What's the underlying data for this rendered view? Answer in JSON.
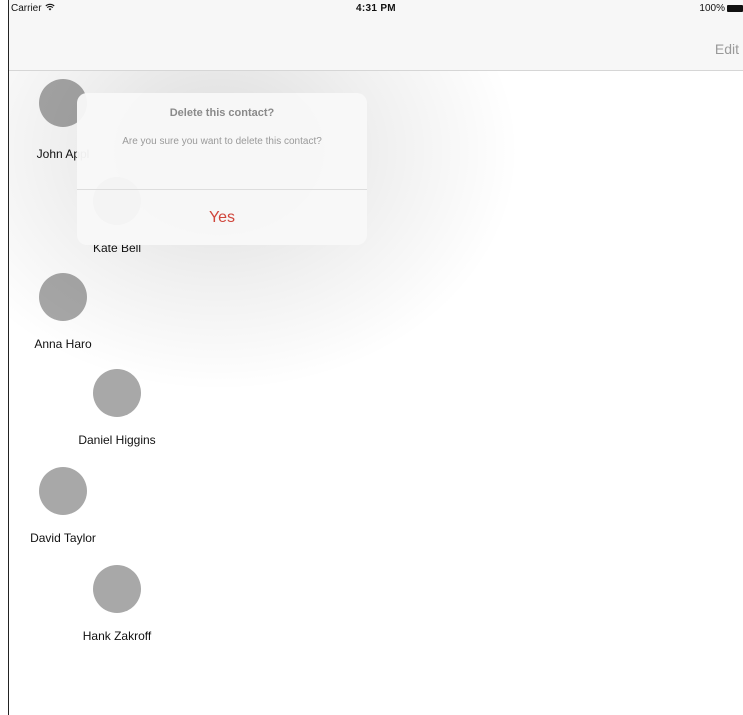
{
  "status_bar": {
    "carrier": "Carrier",
    "wifi_icon": "wifi-icon",
    "time": "4:31 PM",
    "battery": "100%",
    "battery_icon": "battery-icon"
  },
  "nav_bar": {
    "edit_label": "Edit"
  },
  "contacts": [
    {
      "name": "John Appl"
    },
    {
      "name": "Kate Bell"
    },
    {
      "name": "Anna Haro"
    },
    {
      "name": "Daniel Higgins"
    },
    {
      "name": "David Taylor"
    },
    {
      "name": "Hank Zakroff"
    }
  ],
  "alert": {
    "title": "Delete this contact?",
    "message": "Are you sure you want to delete this contact?",
    "confirm_label": "Yes",
    "confirm_color": "#d0463c"
  },
  "colors": {
    "avatar": "#a8a8a8",
    "edit_button": "#9a9a9a"
  }
}
